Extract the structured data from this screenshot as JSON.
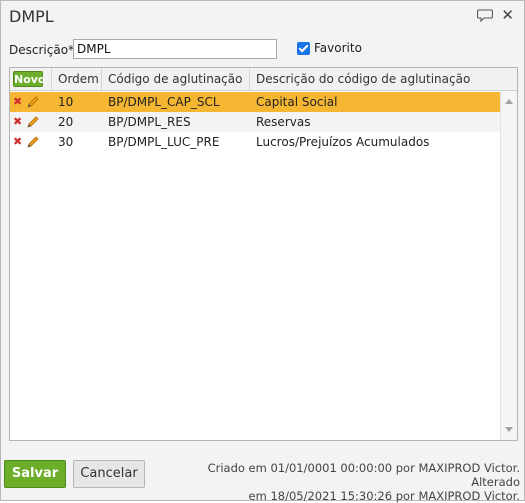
{
  "dialog": {
    "title": "DMPL"
  },
  "form": {
    "descricao_label": "Descrição*",
    "descricao_value": "DMPL",
    "favorito_label": "Favorito",
    "favorito_checked": true
  },
  "grid": {
    "novo_label": "Novo",
    "columns": [
      "Ordem",
      "Código de aglutinação",
      "Descrição do código de aglutinação"
    ],
    "rows": [
      {
        "ordem": "10",
        "codigo": "BP/DMPL_CAP_SCL",
        "descricao": "Capital Social",
        "selected": true
      },
      {
        "ordem": "20",
        "codigo": "BP/DMPL_RES",
        "descricao": "Reservas",
        "selected": false
      },
      {
        "ordem": "30",
        "codigo": "BP/DMPL_LUC_PRE",
        "descricao": "Lucros/Prejuízos Acumulados",
        "selected": false
      }
    ]
  },
  "footer": {
    "save_label": "Salvar",
    "cancel_label": "Cancelar",
    "audit_line1": "Criado em 01/01/0001 00:00:00 por MAXIPROD Victor. Alterado",
    "audit_line2": "em 18/05/2021 15:30:26 por MAXIPROD Victor."
  },
  "colors": {
    "accent_green": "#6cae2a",
    "selection_orange": "#f5b731",
    "delete_red": "#d03030"
  },
  "icons": [
    "comment-icon",
    "close-icon",
    "delete-icon",
    "edit-icon"
  ]
}
